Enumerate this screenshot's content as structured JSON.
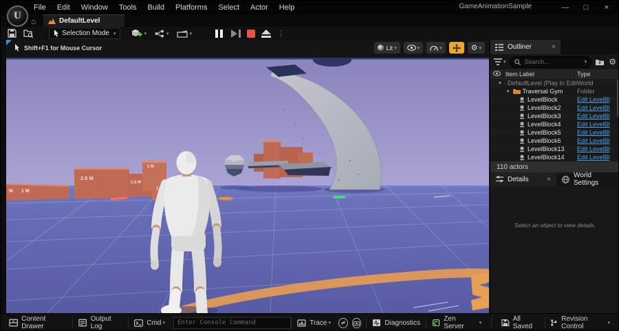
{
  "titlebar": {
    "title": "GameAnimationSample",
    "menus": [
      "File",
      "Edit",
      "Window",
      "Tools",
      "Build",
      "Platforms",
      "Select",
      "Actor",
      "Help"
    ],
    "minimize": "—",
    "maximize": "□",
    "close": "×"
  },
  "tabbar": {
    "level_tab": "DefaultLevel"
  },
  "toolbar": {
    "selection_mode": "Selection Mode"
  },
  "viewport": {
    "hint": "Shift+F1 for Mouse Cursor",
    "view_mode": "Lit"
  },
  "scene": {
    "wall_labels": {
      "w0": "M",
      "w1": "1 M",
      "w2": "2.5 M",
      "w3": "1.5 M",
      "w4": "1 M",
      "w5": "1 M"
    }
  },
  "outliner": {
    "tab": "Outliner",
    "search_placeholder": "Search...",
    "columns": {
      "item": "Item Label",
      "type": "Type"
    },
    "rows": [
      {
        "label": "DefaultLevel (Play In Edit",
        "type": "World"
      },
      {
        "label": "Traversal Gym",
        "type": "Folder"
      },
      {
        "label": "LevelBlock",
        "type": "Edit LevelBl"
      },
      {
        "label": "LevelBlock2",
        "type": "Edit LevelBl"
      },
      {
        "label": "LevelBlock3",
        "type": "Edit LevelBl"
      },
      {
        "label": "LevelBlock4",
        "type": "Edit LevelBl"
      },
      {
        "label": "LevelBlock5",
        "type": "Edit LevelBl"
      },
      {
        "label": "LevelBlock6",
        "type": "Edit LevelBl"
      },
      {
        "label": "LevelBlock13",
        "type": "Edit LevelBl"
      },
      {
        "label": "LevelBlock14",
        "type": "Edit LevelBl"
      }
    ],
    "footer": "110 actors"
  },
  "details": {
    "tab": "Details",
    "world_settings_tab": "World Settings",
    "empty_message": "Select an object to view details."
  },
  "statusbar": {
    "content_drawer": "Content Drawer",
    "output_log": "Output Log",
    "cmd": "Cmd",
    "console_placeholder": "Enter Console Command",
    "trace": "Trace",
    "diagnostics": "Diagnostics",
    "zen_server": "Zen Server",
    "all_saved": "All Saved",
    "revision_control": "Revision Control"
  },
  "colors": {
    "accent_yellow": "#eda72b",
    "stop_red": "#e0544a",
    "link_blue": "#4da3e8",
    "zen_green": "#37c837"
  }
}
